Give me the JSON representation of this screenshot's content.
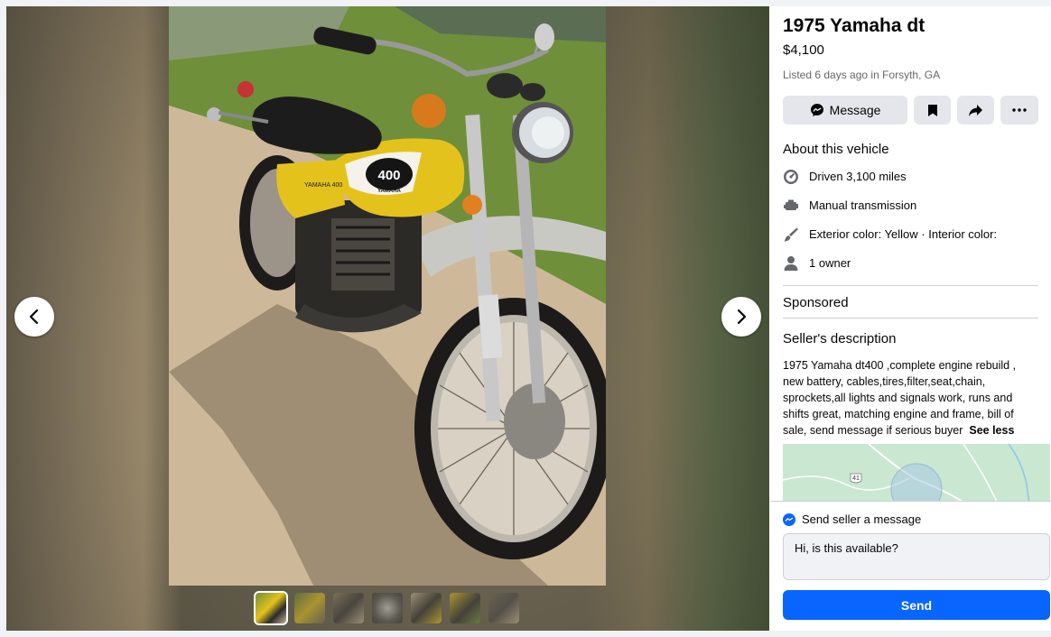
{
  "listing": {
    "title": "1975 Yamaha dt",
    "price": "$4,100",
    "listed": "Listed 6 days ago in Forsyth, GA"
  },
  "actions": {
    "message_label": "Message"
  },
  "about": {
    "heading": "About this vehicle",
    "details": [
      {
        "icon": "speedometer-icon",
        "text": "Driven 3,100 miles"
      },
      {
        "icon": "engine-icon",
        "text": "Manual transmission"
      },
      {
        "icon": "paint-brush-icon",
        "text": "Exterior color: Yellow · Interior color:"
      },
      {
        "icon": "person-icon",
        "text": "1 owner"
      }
    ]
  },
  "sponsored": "Sponsored",
  "seller": {
    "heading": "Seller's description",
    "description": "1975 Yamaha dt400 ,complete engine rebuild , new battery, cables,tires,filter,seat,chain, sprockets,all lights and signals work, runs and shifts great, matching engine and frame, bill of sale, send message if serious buyer",
    "see_less": "See less"
  },
  "map": {
    "route_label": "41"
  },
  "photo": {
    "tank_badge": "400",
    "tank_brand": "YAMAHA",
    "side_badge": "YAMAHA 400"
  },
  "compose": {
    "heading": "Send seller a message",
    "message": "Hi, is this available?",
    "send_label": "Send"
  },
  "thumbnails": {
    "count": 7,
    "active": 0
  },
  "colors": {
    "accent": "#0866ff",
    "button_bg": "#e4e6eb",
    "secondary_text": "#65676b"
  }
}
